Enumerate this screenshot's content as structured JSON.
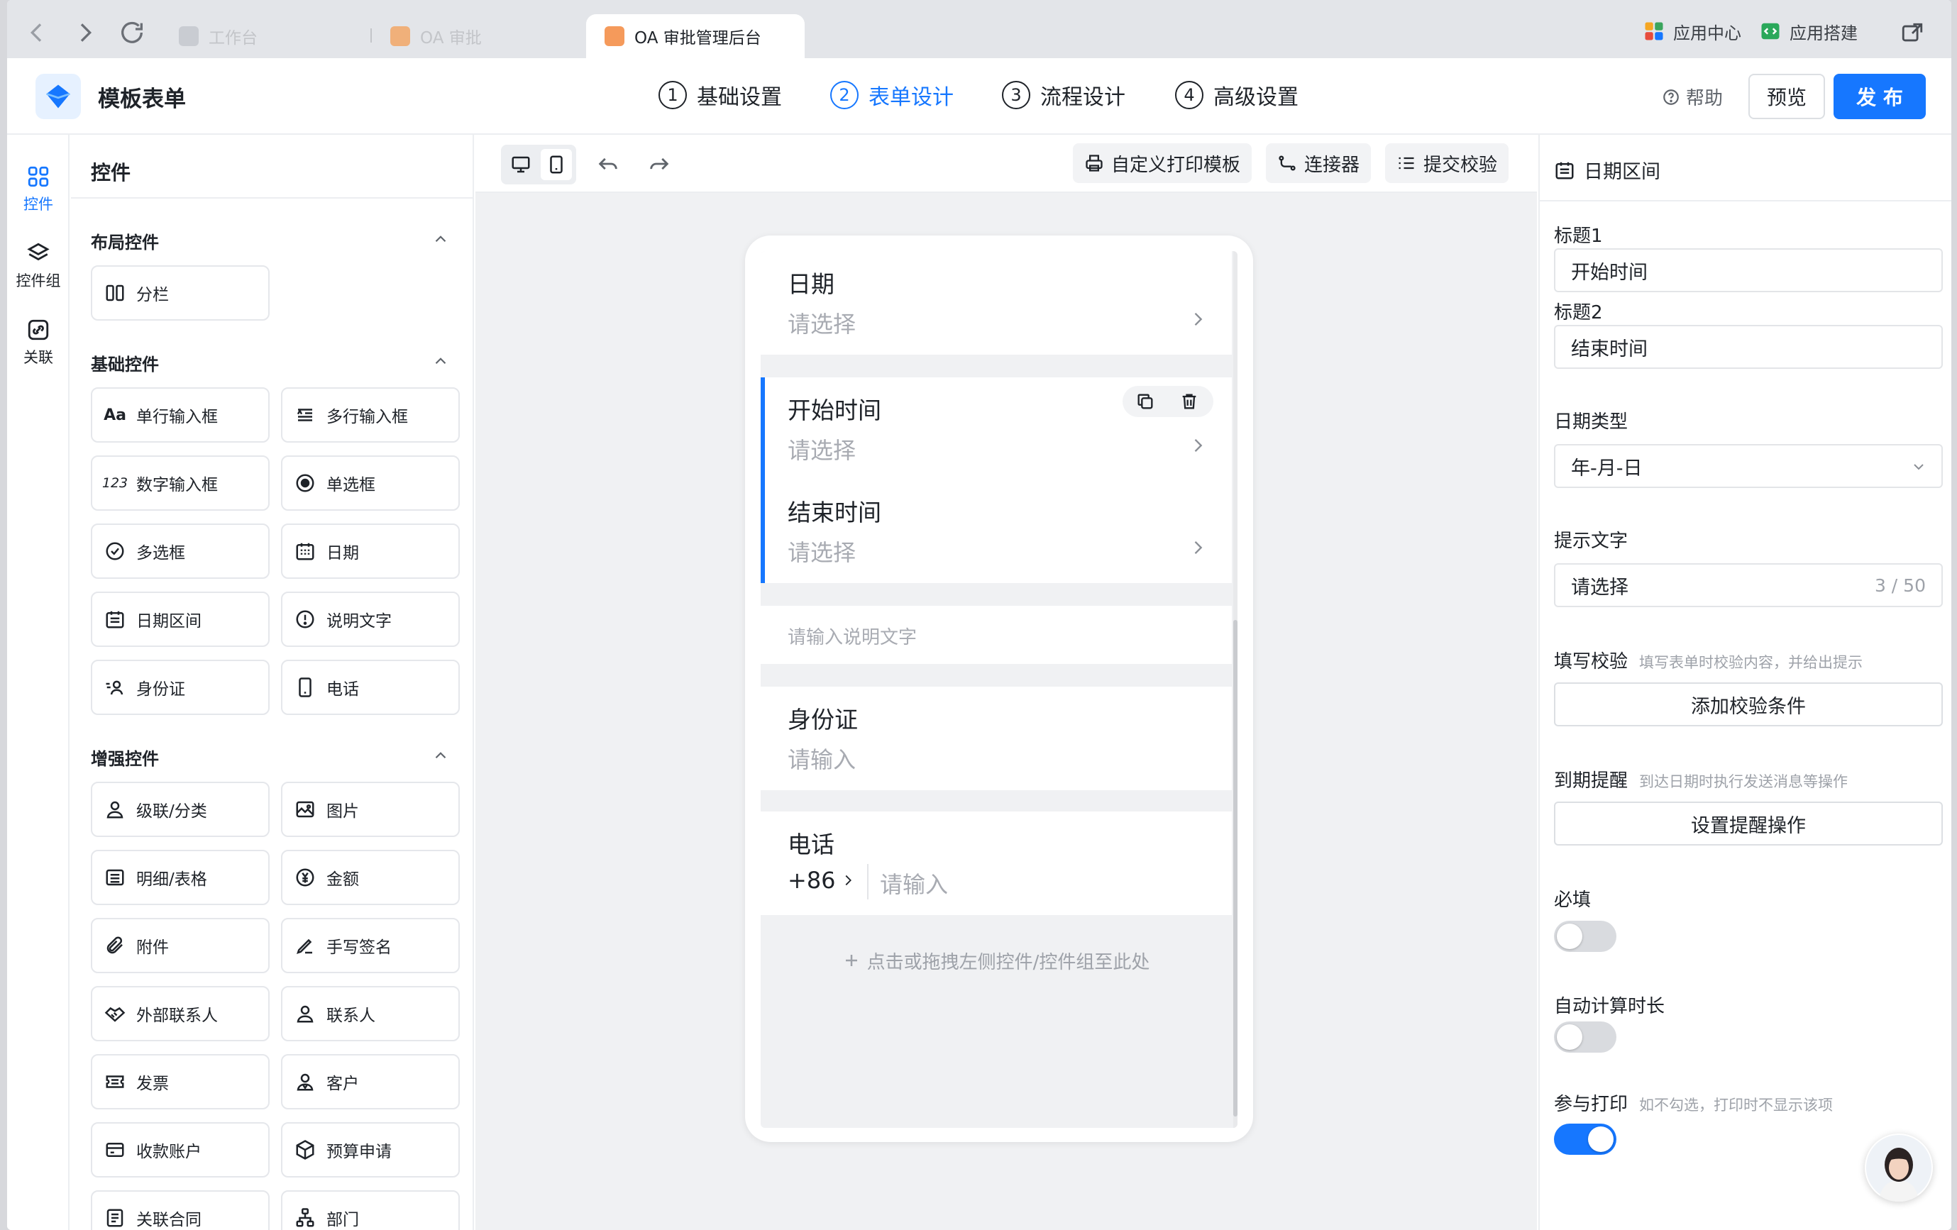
{
  "browser": {
    "tabs": [
      {
        "label": "工作台"
      },
      {
        "label": "OA 审批"
      },
      {
        "label": "OA 审批管理后台"
      }
    ],
    "app_center": "应用中心",
    "app_build": "应用搭建"
  },
  "header": {
    "title": "模板表单",
    "steps": [
      {
        "num": "1",
        "label": "基础设置"
      },
      {
        "num": "2",
        "label": "表单设计"
      },
      {
        "num": "3",
        "label": "流程设计"
      },
      {
        "num": "4",
        "label": "高级设置"
      }
    ],
    "help": "帮助",
    "preview": "预览",
    "publish": "发 布"
  },
  "rail": [
    {
      "label": "控件"
    },
    {
      "label": "控件组"
    },
    {
      "label": "关联"
    }
  ],
  "panel": {
    "title": "控件",
    "sections": [
      {
        "title": "布局控件",
        "items": [
          "分栏"
        ]
      },
      {
        "title": "基础控件",
        "items": [
          "单行输入框",
          "多行输入框",
          "数字输入框",
          "单选框",
          "多选框",
          "日期",
          "日期区间",
          "说明文字",
          "身份证",
          "电话"
        ]
      },
      {
        "title": "增强控件",
        "items": [
          "级联/分类",
          "图片",
          "明细/表格",
          "金额",
          "附件",
          "手写签名",
          "外部联系人",
          "联系人",
          "发票",
          "客户",
          "收款账户",
          "预算申请",
          "关联合同",
          "部门"
        ]
      }
    ]
  },
  "toolbar": {
    "print": "自定义打印模板",
    "connector": "连接器",
    "submit_check": "提交校验"
  },
  "form": {
    "date_label": "日期",
    "date_ph": "请选择",
    "start_label": "开始时间",
    "start_ph": "请选择",
    "end_label": "结束时间",
    "end_ph": "请选择",
    "desc_ph": "请输入说明文字",
    "id_label": "身份证",
    "id_ph": "请输入",
    "phone_label": "电话",
    "phone_code": "+86",
    "phone_ph": "请输入",
    "drop_hint": "点击或拖拽左侧控件/控件组至此处"
  },
  "props": {
    "title": "日期区间",
    "title1_label": "标题1",
    "title1_value": "开始时间",
    "title2_label": "标题2",
    "title2_value": "结束时间",
    "date_type_label": "日期类型",
    "date_type_value": "年-月-日",
    "hint_label": "提示文字",
    "hint_value": "请选择",
    "hint_count": "3 / 50",
    "validate_label": "填写校验",
    "validate_hint": "填写表单时校验内容，并给出提示",
    "validate_btn": "添加校验条件",
    "remind_label": "到期提醒",
    "remind_hint": "到达日期时执行发送消息等操作",
    "remind_btn": "设置提醒操作",
    "required_label": "必填",
    "required_on": false,
    "auto_calc_label": "自动计算时长",
    "auto_calc_on": false,
    "print_label": "参与打印",
    "print_hint": "如不勾选，打印时不显示该项",
    "print_on": true
  },
  "colors": {
    "accent": "#1677ff"
  }
}
